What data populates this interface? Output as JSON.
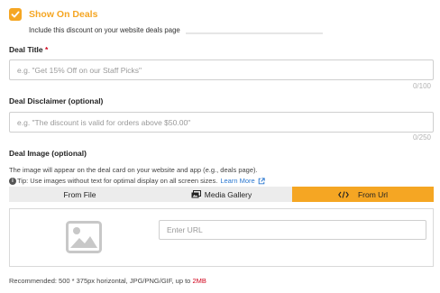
{
  "show_on_deals": {
    "label": "Show On Deals",
    "checked": true,
    "description": "Include this discount on your website deals page"
  },
  "deal_title": {
    "label": "Deal Title",
    "required_mark": "*",
    "placeholder": "e.g. \"Get 15% Off on our Staff Picks\"",
    "value": "",
    "counter": "0/100"
  },
  "deal_disclaimer": {
    "label": "Deal Disclaimer (optional)",
    "placeholder": "e.g. \"The discount is valid for orders above $50.00\"",
    "value": "",
    "counter": "0/250"
  },
  "deal_image": {
    "label": "Deal Image (optional)",
    "description": "The image will appear on the deal card on your website and app (e.g., deals page).",
    "tip_icon": "i",
    "tip": "Tip: Use images without text for optimal display on all screen sizes.",
    "learn_more": "Learn More",
    "tabs": [
      {
        "label": "From File",
        "icon": "",
        "active": false
      },
      {
        "label": "Media Gallery",
        "icon": "gallery-icon",
        "active": false
      },
      {
        "label": "From Url",
        "icon": "code-icon",
        "active": true
      }
    ],
    "url_placeholder": "Enter URL",
    "recommended_prefix": "Recommended: 500 * 375px horizontal, JPG/PNG/GIF, up to",
    "recommended_size": "2MB"
  },
  "colors": {
    "accent": "#f5a623",
    "link": "#2b78d0",
    "required": "#d0021b"
  }
}
